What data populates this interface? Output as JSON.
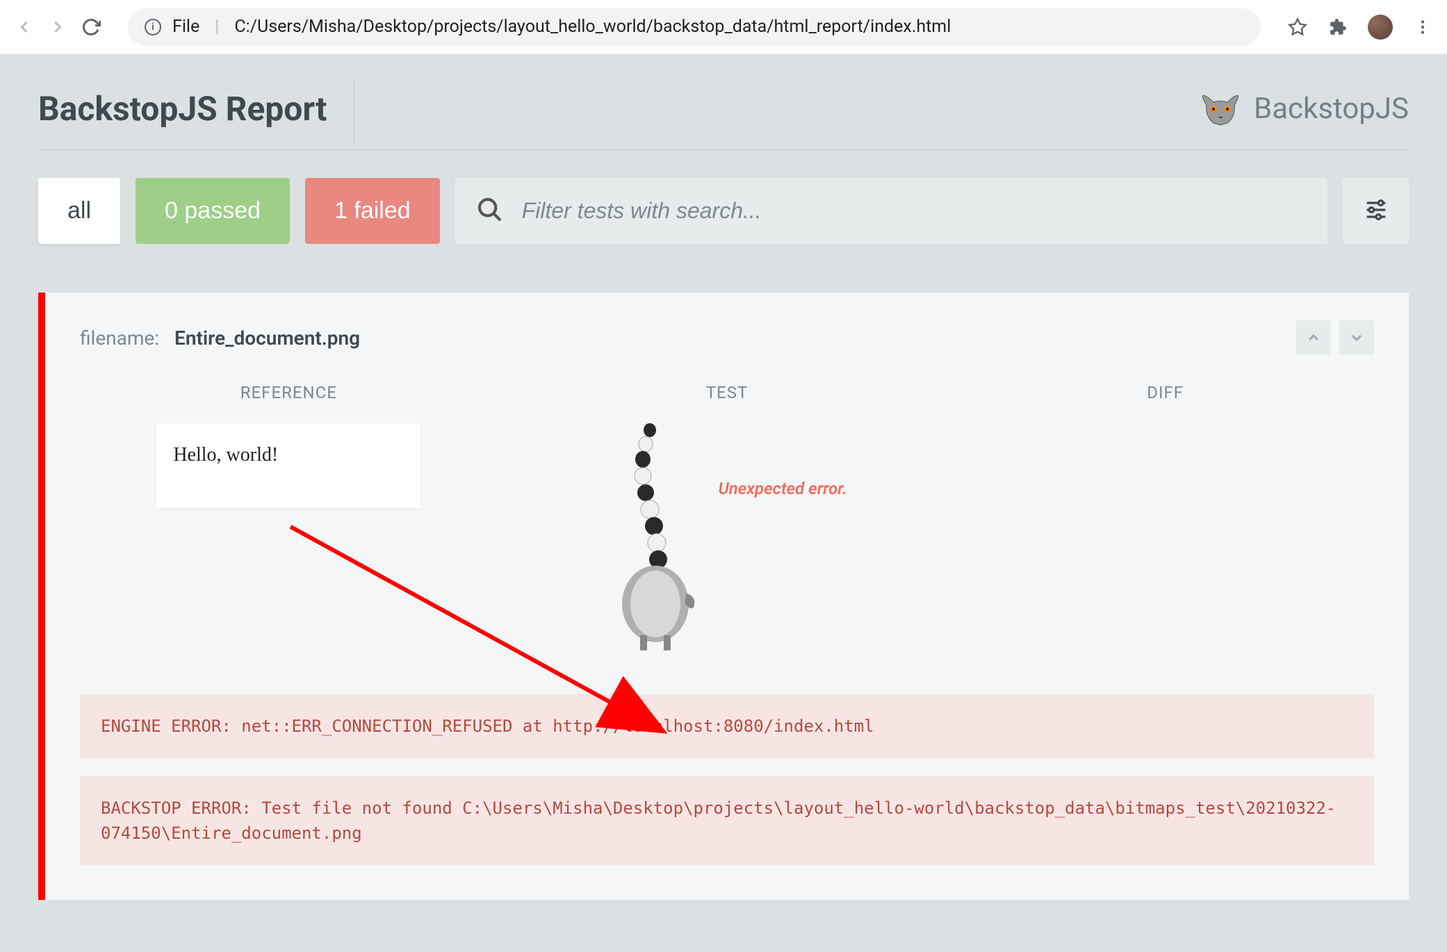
{
  "browser": {
    "url_scheme": "File",
    "url_path": "C:/Users/Misha/Desktop/projects/layout_hello_world/backstop_data/html_report/index.html"
  },
  "header": {
    "title": "BackstopJS Report",
    "brand": "BackstopJS"
  },
  "filters": {
    "all": "all",
    "passed": "0 passed",
    "failed": "1 failed"
  },
  "search": {
    "placeholder": "Filter tests with search..."
  },
  "test": {
    "filename_label": "filename:",
    "filename": "Entire_document.png",
    "columns": {
      "reference": "REFERENCE",
      "test": "TEST",
      "diff": "DIFF"
    },
    "reference_content": "Hello, world!",
    "test_error": "Unexpected error.",
    "errors": [
      "ENGINE ERROR: net::ERR_CONNECTION_REFUSED at http://localhost:8080/index.html",
      "BACKSTOP ERROR: Test file not found C:\\Users\\Misha\\Desktop\\projects\\layout_hello-world\\backstop_data\\bitmaps_test\\20210322-074150\\Entire_document.png"
    ]
  }
}
